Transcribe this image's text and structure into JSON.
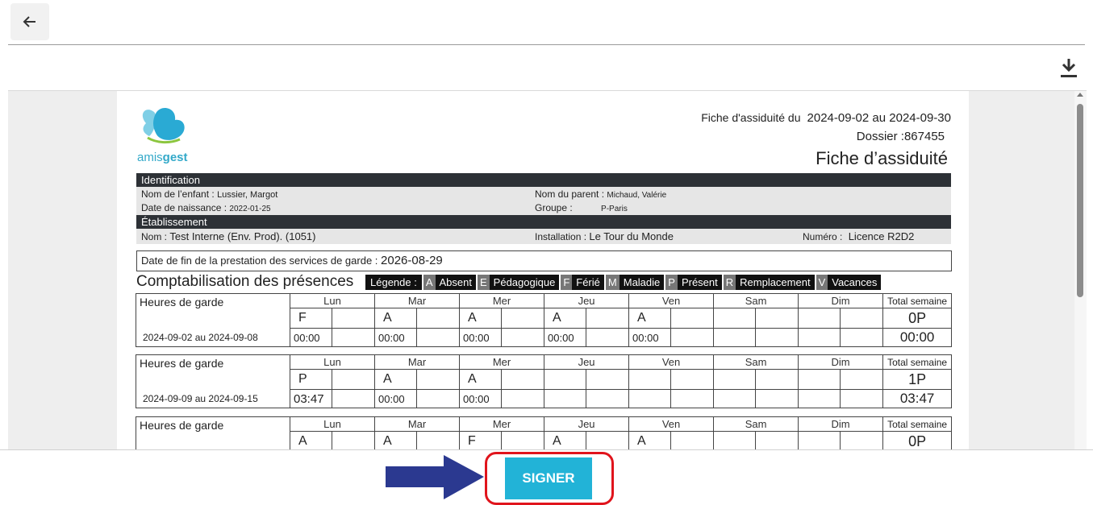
{
  "header": {
    "period_label": "Fiche d'assiduité du",
    "period_value": "2024-09-02 au 2024-09-30",
    "dossier": "Dossier :867455",
    "title": "Fiche d’assiduité"
  },
  "logo": {
    "text_a": "amis",
    "text_b": "gest"
  },
  "identification": {
    "title": "Identification",
    "child_label": "Nom de l’enfant :",
    "child_value": "Lussier, Margot",
    "parent_label": "Nom du parent :",
    "parent_value": "Michaud, Valérie",
    "birth_label": "Date de naissance :",
    "birth_value": "2022-01-25",
    "group_label": "Groupe :",
    "group_value": "P-Paris"
  },
  "etablissement": {
    "title": "Établissement",
    "name_label": "Nom :",
    "name_value": "Test Interne (Env. Prod). (1051)",
    "install_label": "Installation :",
    "install_value": "Le Tour du Monde",
    "numero_label": "Numéro :",
    "numero_value": "Licence R2D2"
  },
  "fin": {
    "label": "Date de fin de la prestation des services de garde :",
    "value": "2026-08-29"
  },
  "comptabilisation": "Comptabilisation des présences",
  "legend": {
    "title": "Légende :",
    "items": [
      {
        "k": "A",
        "v": "Absent"
      },
      {
        "k": "E",
        "v": "Pédagogique"
      },
      {
        "k": "F",
        "v": "Férié"
      },
      {
        "k": "M",
        "v": "Maladie"
      },
      {
        "k": "P",
        "v": "Présent"
      },
      {
        "k": "R",
        "v": "Remplacement"
      },
      {
        "k": "V",
        "v": "Vacances"
      }
    ]
  },
  "days": [
    "Lun",
    "Mar",
    "Mer",
    "Jeu",
    "Ven",
    "Sam",
    "Dim"
  ],
  "total_label": "Total semaine",
  "hours_label": "Heures de garde",
  "weeks": [
    {
      "range": "2024-09-02 au 2024-09-08",
      "codes": [
        "F",
        "A",
        "A",
        "A",
        "A",
        "",
        ""
      ],
      "times": [
        "00:00",
        "00:00",
        "00:00",
        "00:00",
        "00:00",
        "",
        ""
      ],
      "total_p": "0P",
      "total_h": "00:00"
    },
    {
      "range": "2024-09-09 au 2024-09-15",
      "codes": [
        "P",
        "A",
        "A",
        "",
        "",
        "",
        ""
      ],
      "times": [
        "03:47",
        "00:00",
        "00:00",
        "",
        "",
        "",
        ""
      ],
      "total_p": "1P",
      "total_h": "03:47"
    },
    {
      "range": "",
      "codes": [
        "A",
        "A",
        "F",
        "A",
        "A",
        "",
        ""
      ],
      "times": [
        "",
        "",
        "",
        "",
        "",
        "",
        ""
      ],
      "total_p": "0P",
      "total_h": ""
    }
  ],
  "signer": {
    "label": "SIGNER"
  },
  "colors": {
    "accent": "#22b3d7",
    "highlight": "#e0141c",
    "arrow": "#2b3990",
    "dark_bar": "#2d3136"
  }
}
